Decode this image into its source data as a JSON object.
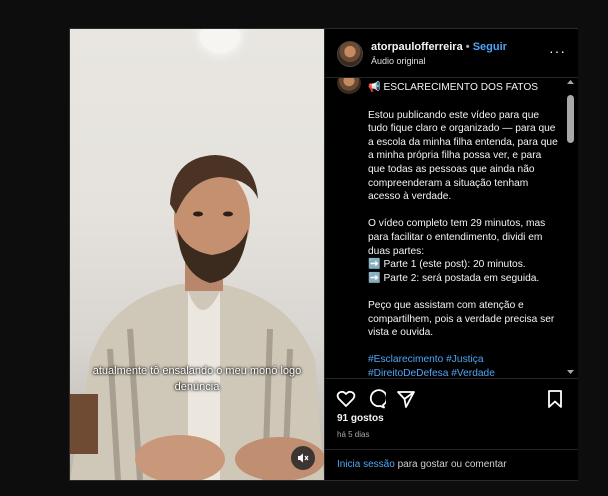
{
  "post": {
    "username": "atorpaulofferreira",
    "separator": "•",
    "follow_label": "Seguir",
    "audio_label": "Áudio original",
    "more_label": "···",
    "title": "📢 ESCLARECIMENTO DOS FATOS",
    "body_p1": "Estou publicando este vídeo para que tudo fique claro e organizado — para que a escola da minha filha entenda, para que a minha própria filha possa ver, e para que todas as pessoas que ainda não compreenderam a situação tenham acesso à verdade.",
    "body_p2": "O vídeo completo tem 29 minutos, mas para facilitar o entendimento, dividi em duas partes:\n➡️ Parte 1 (este post): 20 minutos.\n➡️ Parte 2: será postada em seguida.",
    "body_p3": "Peço que assistam com atenção e compartilhem, pois a verdade precisa ser vista e ouvida.",
    "hashtags": "#Esclarecimento #Justiça #DireitoDeDefesa #Verdade",
    "likes": "91 gostos",
    "age": "há 5 dias",
    "login_link": "Inicia sessão",
    "login_rest": " para gostar ou comentar"
  },
  "video": {
    "caption": "atualmente tô ensalando o meu monó logo denúncia"
  },
  "icons": [
    "heart-icon",
    "comment-icon",
    "share-icon",
    "bookmark-icon",
    "mute-icon",
    "more-icon"
  ],
  "colors": {
    "link": "#4ea5f8",
    "background": "#000000",
    "border": "#262626"
  }
}
